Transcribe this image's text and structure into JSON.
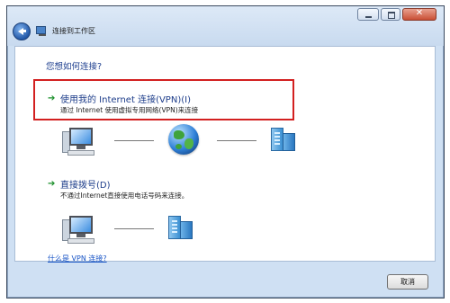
{
  "window": {
    "title": "连接到工作区"
  },
  "content": {
    "heading": "您想如何连接?",
    "options": [
      {
        "title": "使用我的 Internet 连接(VPN)(I)",
        "description": "通过 Internet 使用虚拟专用网络(VPN)来连接"
      },
      {
        "title": "直接拨号(D)",
        "description": "不通过Internet直接使用电话号码来连接。"
      }
    ],
    "help_link": "什么是 VPN 连接?"
  },
  "footer": {
    "cancel_label": "取消"
  },
  "colors": {
    "highlight_border": "#d32020",
    "heading_text": "#1e3f8f",
    "link_text": "#1a56c7",
    "arrow_green": "#1a8f2a"
  }
}
